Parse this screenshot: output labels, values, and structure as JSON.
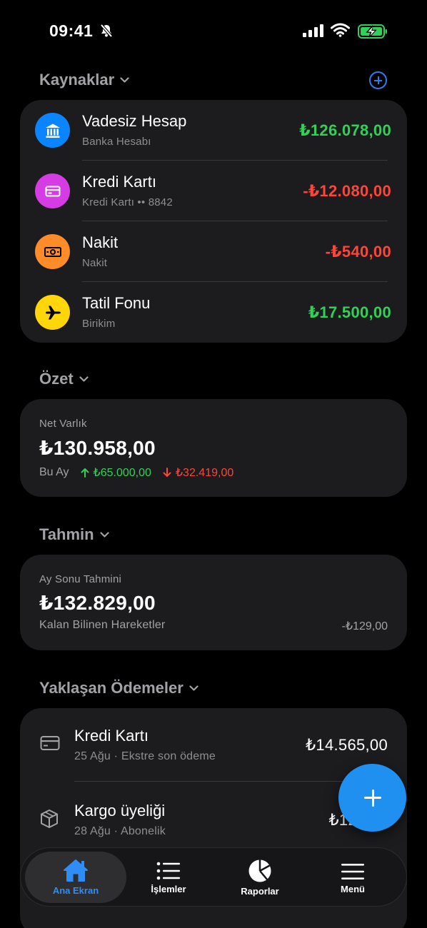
{
  "status_bar": {
    "time": "09:41"
  },
  "sources": {
    "title": "Kaynaklar",
    "accounts": [
      {
        "name": "Vadesiz Hesap",
        "sub": "Banka Hesabı",
        "amount": "₺126.078,00",
        "amount_color": "#30d158",
        "icon": "bank-icon",
        "icon_color": "#0a84ff"
      },
      {
        "name": "Kredi Kartı",
        "sub": "Kredi Kartı •• 8842",
        "amount": "-₺12.080,00",
        "amount_color": "#ff453a",
        "icon": "credit-card-icon",
        "icon_color": "#d63ce3"
      },
      {
        "name": "Nakit",
        "sub": "Nakit",
        "amount": "-₺540,00",
        "amount_color": "#ff453a",
        "icon": "cash-icon",
        "icon_color": "#ff8c28"
      },
      {
        "name": "Tatil Fonu",
        "sub": "Birikim",
        "amount": "₺17.500,00",
        "amount_color": "#30d158",
        "icon": "airplane-icon",
        "icon_color": "#ffd60a"
      }
    ]
  },
  "summary": {
    "title": "Özet",
    "label": "Net Varlık",
    "net_worth": "₺130.958,00",
    "period_label": "Bu Ay",
    "income": "₺65.000,00",
    "expense": "₺32.419,00"
  },
  "forecast": {
    "title": "Tahmin",
    "label": "Ay Sonu Tahmini",
    "value": "₺132.829,00",
    "remaining_label": "Kalan Bilinen Hareketler",
    "remaining_value": "-₺129,00"
  },
  "upcoming": {
    "title": "Yaklaşan Ödemeler",
    "items": [
      {
        "name": "Kredi Kartı",
        "sub": "25 Ağu · Ekstre son ödeme",
        "amount": "₺14.565,00",
        "icon": "credit-card-icon"
      },
      {
        "name": "Kargo üyeliği",
        "sub": "28 Ağu · Abonelik",
        "amount": "₺12",
        "icon": "package-icon"
      }
    ]
  },
  "tabs": [
    {
      "label": "Ana Ekran",
      "icon": "house-icon",
      "active": true
    },
    {
      "label": "İşlemler",
      "icon": "list-icon",
      "active": false
    },
    {
      "label": "Raporlar",
      "icon": "pie-chart-icon",
      "active": false
    },
    {
      "label": "Menü",
      "icon": "menu-icon",
      "active": false
    }
  ],
  "colors": {
    "accent": "#2f8ef5",
    "fab": "#1f8ff0",
    "income": "#30d158",
    "expense": "#ff453a",
    "card": "#1c1c1e"
  }
}
